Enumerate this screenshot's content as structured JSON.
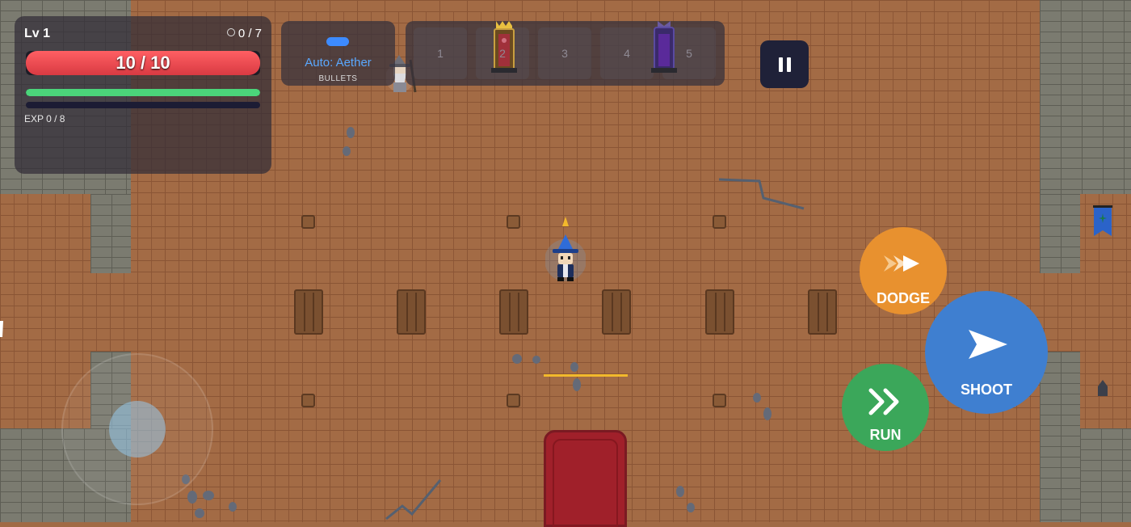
{
  "hud": {
    "level_label": "Lv 1",
    "orbs_text": "0 / 7",
    "hp": {
      "current": 10,
      "max": 10,
      "text": "10 / 10"
    },
    "mana_fraction": 1.0,
    "exp": {
      "current": 0,
      "max": 8,
      "text": "EXP 0 / 8"
    }
  },
  "weapon": {
    "name": "Auto: Aether",
    "type": "BULLETS"
  },
  "slots": [
    {
      "number": "1",
      "item": ""
    },
    {
      "number": "2",
      "item": "red-throne-icon"
    },
    {
      "number": "3",
      "item": ""
    },
    {
      "number": "4",
      "item": ""
    },
    {
      "number": "5",
      "item": "purple-throne-icon"
    }
  ],
  "controls": {
    "dodge_label": "DODGE",
    "run_label": "RUN",
    "shoot_label": "SHOOT"
  },
  "colors": {
    "hp": "#e24149",
    "mana": "#4bd47a",
    "dodge": "#e8912f",
    "run": "#3ba75a",
    "shoot": "#3f7fd0",
    "weapon_name": "#5aa8ff"
  }
}
